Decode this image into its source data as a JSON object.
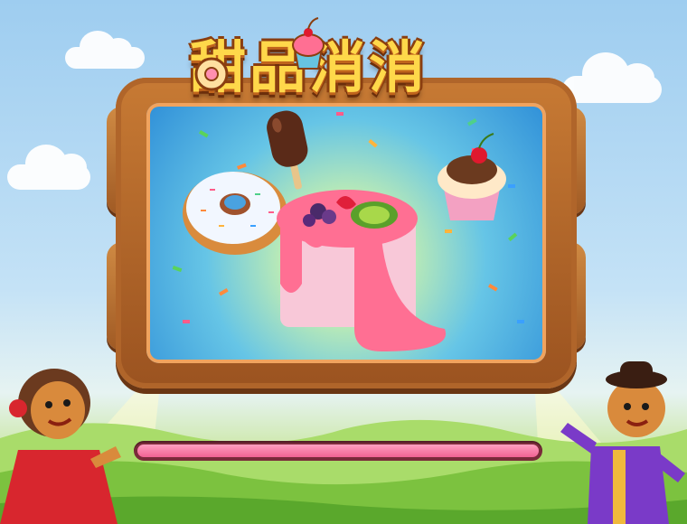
{
  "game": {
    "title": "甜品消消",
    "loading_progress": 1.0
  },
  "colors": {
    "title_fill": "#ffd84a",
    "title_outline": "#8a3e10",
    "progress_fill": "#f06293",
    "progress_track": "#7a2a3a",
    "wood": "#b0652a"
  },
  "icons": {
    "title_donut": "donut-icon",
    "title_cupcake": "cupcake-icon",
    "desserts": [
      "donut-icon",
      "popsicle-icon",
      "cupcake-icon",
      "cake-icon"
    ],
    "characters": [
      "gingerbread-girl-icon",
      "gingerbread-boy-icon"
    ]
  }
}
